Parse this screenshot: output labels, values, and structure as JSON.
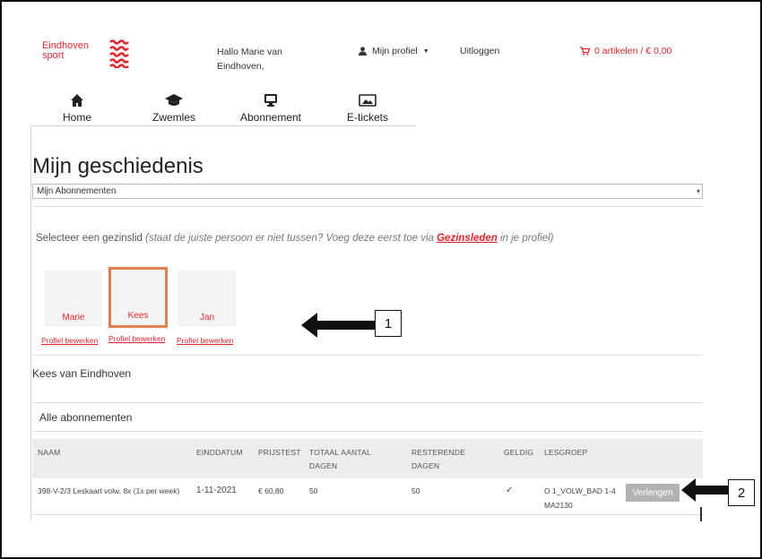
{
  "header": {
    "logo_line1": "Eindhoven",
    "logo_line2": "sport",
    "greeting": "Hallo Marie van Eindhoven,",
    "profile_label": "Mijn profiel",
    "logout_label": "Uitloggen",
    "cart_label": "0 artikelen / € 0,00"
  },
  "nav": [
    {
      "label": "Home",
      "icon": "home-icon"
    },
    {
      "label": "Zwemles",
      "icon": "graduation-cap-icon"
    },
    {
      "label": "Abonnement",
      "icon": "monitor-icon"
    },
    {
      "label": "E-tickets",
      "icon": "image-ticket-icon"
    }
  ],
  "page_title": "Mijn geschiedenis",
  "history_select": {
    "selected": "Mijn Abonnementen"
  },
  "instruction": {
    "main": "Selecteer een gezinslid",
    "hint_before": "(staat de juiste persoon er niet tussen? Voeg deze eerst toe via",
    "link": "Gezinsleden",
    "hint_after": "in je profiel)"
  },
  "members": [
    {
      "name": "Marie",
      "edit_label": "Profiel bewerken",
      "selected": false
    },
    {
      "name": "Kees",
      "edit_label": "Profiel bewerken",
      "selected": true
    },
    {
      "name": "Jan",
      "edit_label": "Profiel bewerken",
      "selected": false
    }
  ],
  "callouts": {
    "one": "1",
    "two": "2"
  },
  "selected_person": "Kees van Eindhoven",
  "section_title": "Alle abonnementen",
  "table": {
    "headers": {
      "naam": "NAAM",
      "einddatum": "EINDDATUM",
      "prijstest": "PRIJSTEST",
      "totaal": "TOTAAL AANTAL DAGEN",
      "resterend": "RESTERENDE DAGEN",
      "geldig": "GELDIG",
      "lesgroep": "LESGROEP"
    },
    "rows": [
      {
        "naam": "398-V-2/3 Leskaart volw. 8x (1x per week)",
        "einddatum": "1-11-2021",
        "prijstest": "€ 60,80",
        "totaal": "50",
        "resterend": "50",
        "geldig": "✓",
        "lesgroep": "O 1_VOLW_BAD 1-4 MA2130",
        "action": "Verlengen"
      }
    ]
  },
  "colors": {
    "brand_red": "#e0262f",
    "selected_border": "#e08050",
    "button_grey": "#b3b3b3"
  }
}
